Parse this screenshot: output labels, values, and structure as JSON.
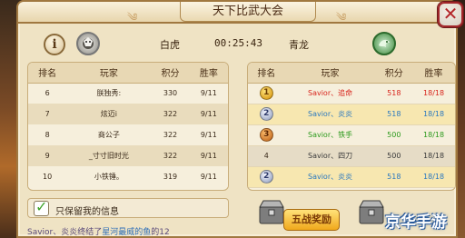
{
  "window": {
    "title": "天下比武大会",
    "close_glyph": "✕",
    "info_glyph": "i"
  },
  "match": {
    "left_team": "白虎",
    "timer": "00:25:43",
    "right_team": "青龙"
  },
  "left_table": {
    "headers": [
      "排名",
      "玩家",
      "积分",
      "胜率"
    ],
    "rows": [
      {
        "rank": "6",
        "player": "朕独秀:",
        "score": "330",
        "rate": "9/11"
      },
      {
        "rank": "7",
        "player": "炫迈i",
        "score": "322",
        "rate": "9/11"
      },
      {
        "rank": "8",
        "player": "商公子",
        "score": "322",
        "rate": "9/11"
      },
      {
        "rank": "9",
        "player": "_寸寸旧时光",
        "score": "322",
        "rate": "9/11"
      },
      {
        "rank": "10",
        "player": "小铁锤。",
        "score": "319",
        "rate": "9/11"
      }
    ]
  },
  "right_table": {
    "headers": [
      "排名",
      "玩家",
      "积分",
      "胜率"
    ],
    "rows": [
      {
        "rank": "1",
        "badge": "gold",
        "player": "Savior、追命",
        "score": "518",
        "rate": "18/18",
        "color": "#d8241c",
        "highlight": false
      },
      {
        "rank": "2",
        "badge": "silver",
        "player": "Savior、炎炎",
        "score": "518",
        "rate": "18/18",
        "color": "#2a78c0",
        "highlight": true
      },
      {
        "rank": "3",
        "badge": "bronze",
        "player": "Savior、铁手",
        "score": "500",
        "rate": "18/18",
        "color": "#2c9a1c",
        "highlight": false
      },
      {
        "rank": "4",
        "badge": "none",
        "player": "Savior、四刀",
        "score": "500",
        "rate": "18/18",
        "color": "#3a3a3a",
        "highlight": false
      },
      {
        "rank": "2",
        "badge": "silver",
        "player": "Savior、炎炎",
        "score": "518",
        "rate": "18/18",
        "color": "#2a78c0",
        "highlight": true
      }
    ]
  },
  "options": {
    "keep_my_info": "只保留我的信息",
    "keep_my_info_checked": true
  },
  "ticker": {
    "name": "Savior、炎炎",
    "text": "终结了",
    "target": "星河最威的鱼",
    "tail": "的12"
  },
  "reward_button": "五战奖励",
  "watermark": "京华手游"
}
